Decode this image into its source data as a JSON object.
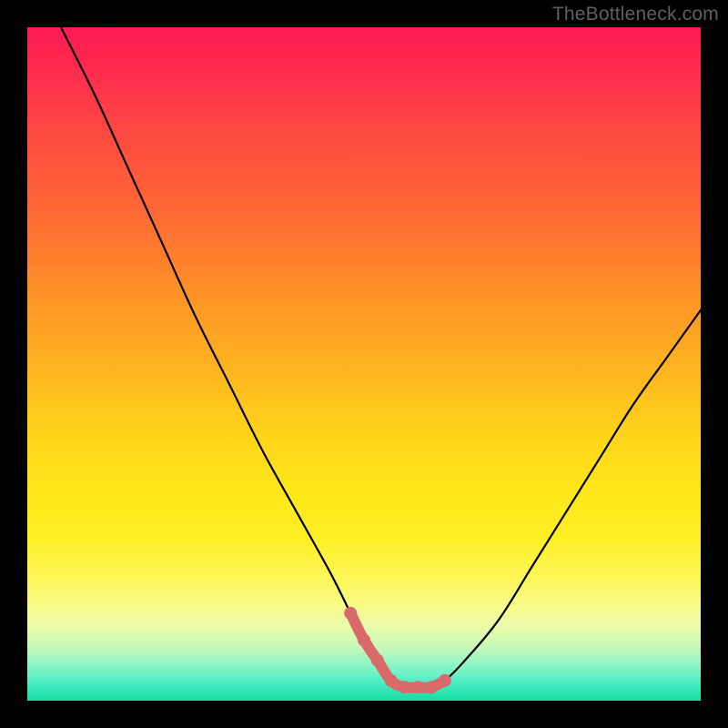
{
  "watermark": "TheBottleneck.com",
  "chart_data": {
    "type": "line",
    "title": "",
    "xlabel": "",
    "ylabel": "",
    "xlim": [
      0,
      100
    ],
    "ylim": [
      0,
      100
    ],
    "series": [
      {
        "name": "curve",
        "color": "#000000",
        "x": [
          5,
          10,
          15,
          20,
          25,
          30,
          35,
          40,
          45,
          48,
          50,
          52,
          54,
          56,
          58,
          60,
          62,
          65,
          70,
          75,
          80,
          85,
          90,
          95,
          100
        ],
        "y": [
          100,
          90,
          79,
          68,
          57,
          47,
          37,
          28,
          19,
          13,
          9,
          6,
          3,
          2,
          2,
          2,
          3,
          6,
          12,
          20,
          28,
          36,
          44,
          51,
          58
        ]
      },
      {
        "name": "highlight",
        "color": "#d96a6a",
        "x": [
          48,
          50,
          52,
          54,
          56,
          58,
          60,
          62
        ],
        "y": [
          13,
          9,
          6,
          3,
          2,
          2,
          2,
          3
        ]
      }
    ],
    "background_gradient": {
      "top": "#ff1a53",
      "mid": "#ffd81a",
      "bottom": "#16dd9f"
    }
  }
}
